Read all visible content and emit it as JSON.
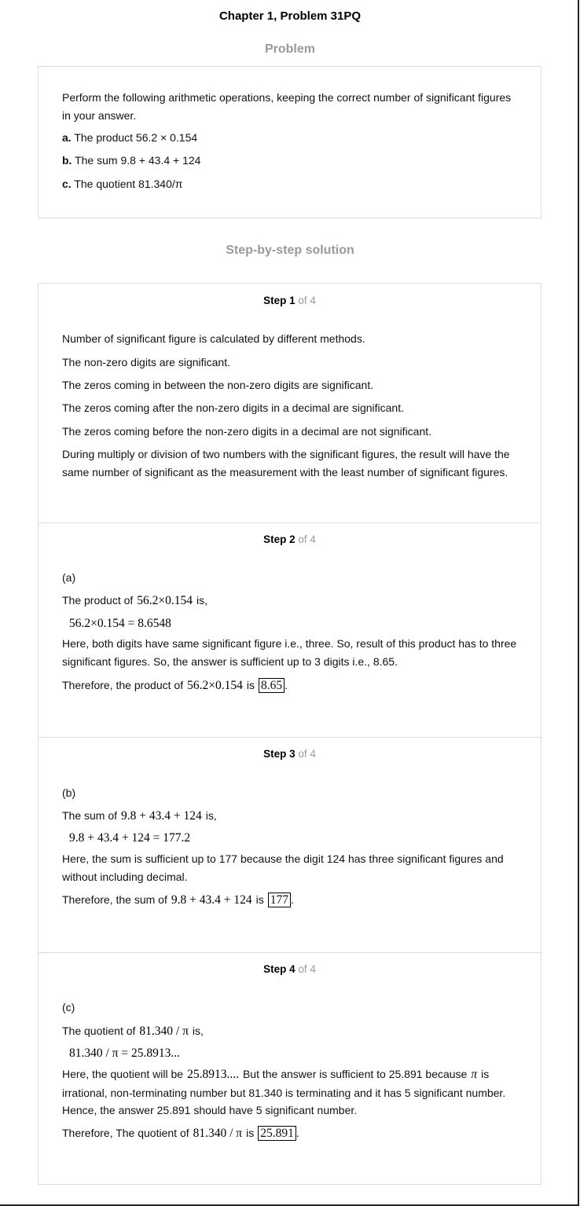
{
  "title": "Chapter 1, Problem 31PQ",
  "problem": {
    "heading": "Problem",
    "intro": "Perform the following arithmetic operations, keeping the correct number of significant figures in your answer.",
    "parts": [
      {
        "label": "a.",
        "text": "The product 56.2 × 0.154"
      },
      {
        "label": "b.",
        "text": "The sum 9.8 + 43.4 + 124"
      },
      {
        "label": "c.",
        "text": "The quotient 81.340/π"
      }
    ]
  },
  "solution": {
    "heading": "Step-by-step solution",
    "steps": [
      {
        "step_word": "Step 1",
        "of_text": "of 4",
        "lines": [
          "Number of significant figure is calculated by different methods.",
          "The non-zero digits are significant.",
          "The zeros coming in between the non-zero digits are significant.",
          "The zeros coming after the non-zero digits in a decimal are significant.",
          "The zeros coming before the non-zero digits in a decimal are not significant.",
          "During multiply or division of two numbers with the significant figures, the result will have the same number of significant as the measurement with the least number of significant figures."
        ]
      },
      {
        "step_word": "Step 2",
        "of_text": "of 4",
        "part": "(a)",
        "lead": "The product of",
        "expr": "56.2×0.154",
        "lead_tail": "is,",
        "equation": "56.2×0.154 = 8.6548",
        "explanation": "Here, both digits have same significant figure i.e., three. So, result of this product has to three significant figures. So, the answer is sufficient up to 3 digits i.e., 8.65.",
        "therefore": "Therefore, the product of",
        "therefore_expr": "56.2×0.154",
        "is_word": "is",
        "answer": "8.65",
        "period": "."
      },
      {
        "step_word": "Step 3",
        "of_text": "of 4",
        "part": "(b)",
        "lead": "The sum of",
        "expr": "9.8 + 43.4 + 124",
        "lead_tail": "is,",
        "equation": "9.8 + 43.4 + 124 = 177.2",
        "explanation": "Here, the sum is sufficient up to 177 because the digit 124 has three significant figures and without including decimal.",
        "therefore": "Therefore, the sum of",
        "therefore_expr": "9.8 + 43.4 + 124",
        "is_word": "is",
        "answer": "177",
        "period": "."
      },
      {
        "step_word": "Step 4",
        "of_text": "of 4",
        "part": "(c)",
        "lead": "The quotient of",
        "expr": "81.340 / π",
        "lead_tail": "is,",
        "equation": "81.340 / π = 25.8913...",
        "expl_a": "Here, the quotient will be",
        "expl_expr": "25.8913....",
        "expl_b": "But the answer is sufficient to 25.891 because",
        "expl_pi": "π",
        "expl_c": "is irrational, non-terminating number but 81.340 is terminating and it has 5 significant number. Hence, the answer 25.891 should have 5 significant number.",
        "therefore": "Therefore, The quotient of",
        "therefore_expr": "81.340 / π",
        "is_word": "is",
        "answer": "25.891",
        "period": "."
      }
    ]
  }
}
